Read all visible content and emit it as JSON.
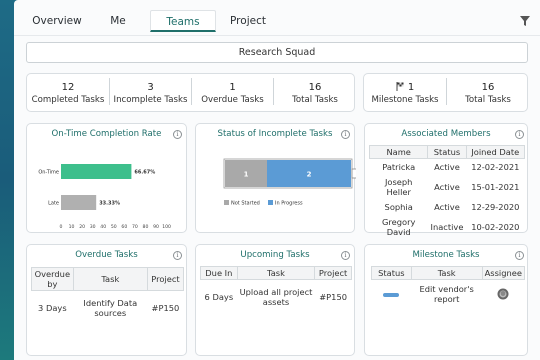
{
  "tabs": [
    {
      "label": "Overview"
    },
    {
      "label": "Me"
    },
    {
      "label": "Teams"
    },
    {
      "label": "Project"
    }
  ],
  "active_tab": "Teams",
  "team_name": "Research Squad",
  "stats": {
    "completed": {
      "value": "12",
      "label": "Completed Tasks"
    },
    "incomplete": {
      "value": "3",
      "label": "Incomplete Tasks"
    },
    "overdue": {
      "value": "1",
      "label": "Overdue Tasks"
    },
    "total": {
      "value": "16",
      "label": "Total Tasks"
    },
    "milestone": {
      "value": "1",
      "label": "Milestone Tasks"
    },
    "milestone_total": {
      "value": "16",
      "label": "Total Tasks"
    }
  },
  "ontime": {
    "title": "On-Time Completion Rate",
    "info": "i"
  },
  "incomplete_status": {
    "title": "Status of Incomplete Tasks",
    "info": "i"
  },
  "members": {
    "title": "Associated Members",
    "info": "i",
    "columns": [
      "Name",
      "Status",
      "Joined Date"
    ],
    "rows": [
      [
        "Patricka",
        "Active",
        "12-02-2021"
      ],
      [
        "Joseph Heller",
        "Active",
        "15-01-2021"
      ],
      [
        "Sophia",
        "Active",
        "12-29-2020"
      ],
      [
        "Gregory David",
        "Inactive",
        "10-02-2020"
      ]
    ]
  },
  "overdue_tasks": {
    "title": "Overdue Tasks",
    "info": "i",
    "columns": [
      "Overdue by",
      "Task",
      "Project"
    ],
    "rows": [
      [
        "3 Days",
        "Identify Data sources",
        "#P150"
      ]
    ]
  },
  "upcoming_tasks": {
    "title": "Upcoming Tasks",
    "info": "i",
    "columns": [
      "Due In",
      "Task",
      "Project"
    ],
    "rows": [
      [
        "6 Days",
        "Upload all project assets",
        "#P150"
      ]
    ]
  },
  "milestone_tasks": {
    "title": "Milestone Tasks",
    "info": "i",
    "columns": [
      "Status",
      "Task",
      "Assignee"
    ],
    "rows": [
      [
        "",
        "Edit vendor's report",
        ""
      ]
    ]
  },
  "colors": {
    "accent": "#1f6f6a",
    "ontime_bar": "#3dbf8c",
    "late_bar": "#b0b0b0",
    "not_started": "#a9a9a9",
    "in_progress": "#5b9bd5"
  },
  "chart_data": [
    {
      "type": "bar",
      "orientation": "horizontal",
      "categories": [
        "On-Time",
        "Late"
      ],
      "values": [
        66.67,
        33.33
      ],
      "data_labels": [
        "66.67%",
        "33.33%"
      ],
      "xticks": [
        "0",
        "10",
        "20",
        "30",
        "40",
        "50",
        "60",
        "70",
        "80",
        "90",
        "100"
      ],
      "xlim": [
        0,
        100
      ]
    },
    {
      "type": "bar",
      "orientation": "horizontal",
      "stacked": true,
      "categories": [
        ""
      ],
      "series": [
        {
          "name": "Not Started",
          "values": [
            1
          ]
        },
        {
          "name": "In Progress",
          "values": [
            2
          ]
        }
      ],
      "legend": "bottom-left"
    }
  ]
}
